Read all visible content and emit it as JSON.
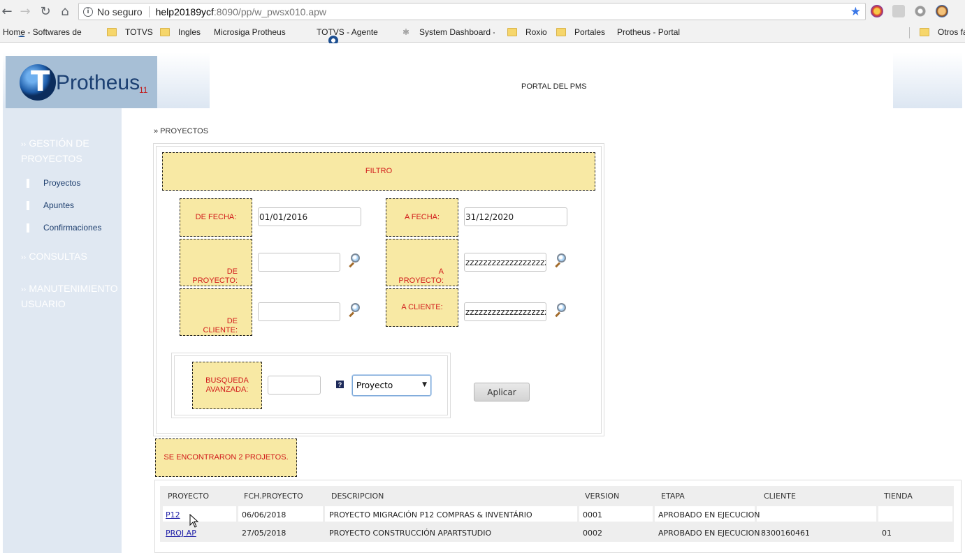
{
  "browser": {
    "security_label": "No seguro",
    "url_host": "help20189ycf",
    "url_rest": ":8090/pp/w_pwsx010.apw",
    "bookmarks": [
      {
        "label": "Home - Softwares de",
        "icon": "globe"
      },
      {
        "label": "TOTVS",
        "icon": "folder"
      },
      {
        "label": "Ingles",
        "icon": "folder"
      },
      {
        "label": "Microsiga Protheus",
        "icon": "page"
      },
      {
        "label": "TOTVS - Agente",
        "icon": "globe"
      },
      {
        "label": "System Dashboard -",
        "icon": "system"
      },
      {
        "label": "Roxio",
        "icon": "folder"
      },
      {
        "label": "Portales",
        "icon": "folder"
      },
      {
        "label": "Protheus - Portal",
        "icon": "page"
      },
      {
        "label": "Otros fa",
        "icon": "folder"
      }
    ]
  },
  "header": {
    "logo_text": "Protheus",
    "logo_version": "11",
    "title": "PORTAL DEL PMS"
  },
  "sidebar": {
    "sections": [
      {
        "label": "GESTIÓN DE PROYECTOS"
      },
      {
        "label": "CONSULTAS"
      },
      {
        "label": "MANUTENIMIENTO USUARIO"
      }
    ],
    "items": [
      {
        "label": "Proyectos"
      },
      {
        "label": "Apuntes"
      },
      {
        "label": "Confirmaciones"
      }
    ]
  },
  "breadcrumb": "» PROYECTOS",
  "filter": {
    "title": "FILTRO",
    "from_date_label": "DE FECHA:",
    "from_date_value": "01/01/2016",
    "to_date_label": "A FECHA:",
    "to_date_value": "31/12/2020",
    "from_project_label_1": "DE",
    "from_project_label_2": "PROYECTO:",
    "from_project_value": "",
    "to_project_label_1": "A",
    "to_project_label_2": "PROYECTO:",
    "to_project_value": "zzzzzzzzzzzzzzzzzzzzzzzz",
    "from_client_label_1": "DE",
    "from_client_label_2": "CLIENTE:",
    "from_client_value": "",
    "to_client_label": "A CLIENTE:",
    "to_client_value": "zzzzzzzzzzzzzzzzzzzzzzzz",
    "advanced_label_1": "BUSQUEDA",
    "advanced_label_2": "AVANZADA:",
    "advanced_value": "",
    "help_label": "?",
    "search_by_selected": "Proyecto",
    "apply_label": "Aplicar"
  },
  "result_message": "SE ENCONTRARON 2 PROJETOS.",
  "table": {
    "headers": [
      "PROYECTO",
      "FCH.PROYECTO",
      "DESCRIPCION",
      "VERSION",
      "ETAPA",
      "CLIENTE",
      "TIENDA"
    ],
    "rows": [
      [
        "P12",
        "06/06/2018",
        "PROYECTO MIGRACIÓN P12 COMPRAS & INVENTÁRIO",
        "0001",
        "APROBADO EN EJECUCION",
        "",
        ""
      ],
      [
        "PROJ AP",
        "27/05/2018",
        "PROYECTO CONSTRUCCIÓN APARTSTUDIO",
        "0002",
        "APROBADO EN EJECUCION",
        "8300160461",
        "01"
      ]
    ]
  }
}
